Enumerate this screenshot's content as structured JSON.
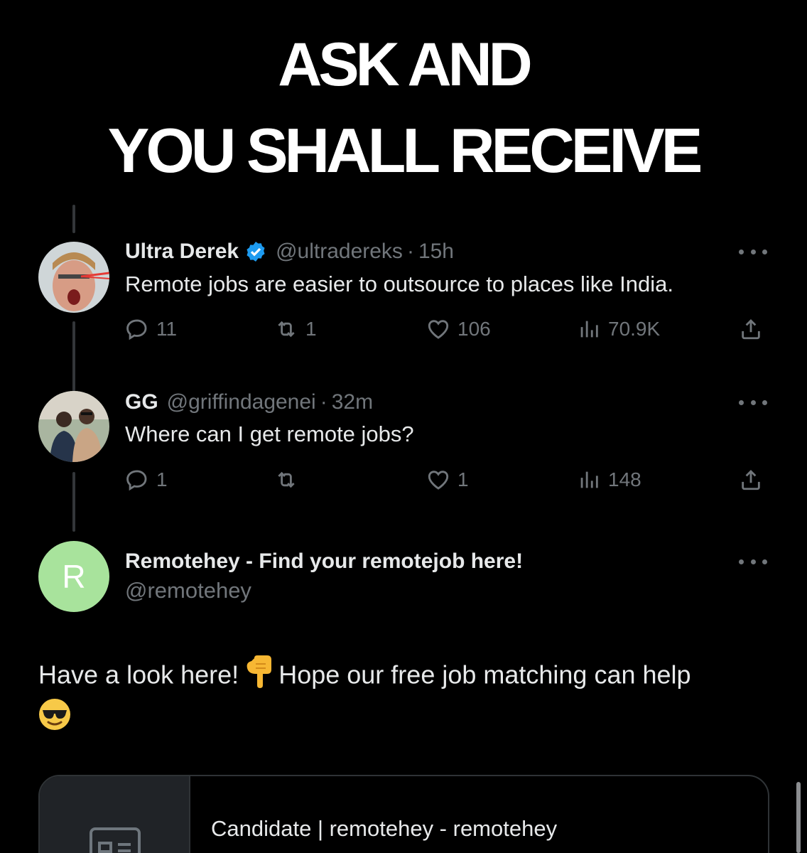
{
  "headline": {
    "line1": "ASK AND",
    "line2": "YOU SHALL RECEIVE"
  },
  "tweets": [
    {
      "name": "Ultra Derek",
      "verified": true,
      "handle": "@ultradereks",
      "time": "15h",
      "text": "Remote jobs are easier to outsource to places like India.",
      "replies": "11",
      "reposts": "1",
      "likes": "106",
      "views": "70.9K"
    },
    {
      "name": "GG",
      "verified": false,
      "handle": "@griffindagenei",
      "time": "32m",
      "text": "Where can I get remote jobs?",
      "replies": "1",
      "reposts": "",
      "likes": "1",
      "views": "148"
    }
  ],
  "reply": {
    "avatar_letter": "R",
    "avatar_color": "#a8e39c",
    "name": "Remotehey - Find your remotejob here!",
    "handle": "@remotehey",
    "text_part1": "Have a look here!",
    "text_part2": "Hope our free job matching can help"
  },
  "card": {
    "title": "Candidate | remotehey - remotehey"
  },
  "colors": {
    "background": "#000000",
    "text": "#e7e9ea",
    "muted": "#71767b",
    "verified": "#1d9bf0"
  }
}
